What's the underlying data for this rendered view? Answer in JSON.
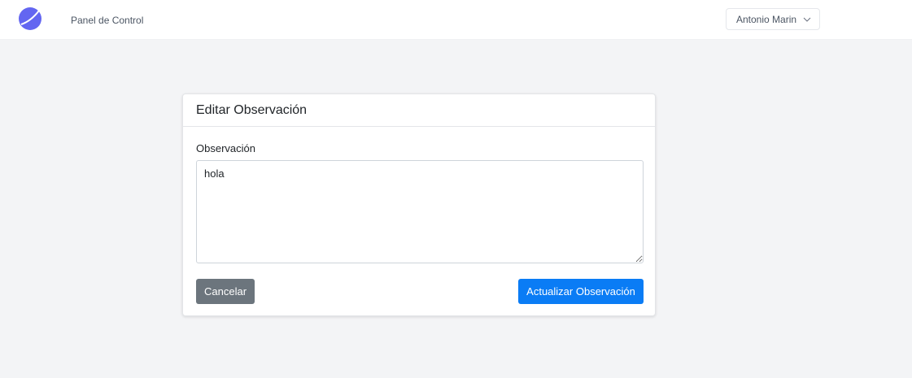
{
  "header": {
    "nav_link": "Panel de Control",
    "user_name": "Antonio Marin"
  },
  "card": {
    "title": "Editar Observación",
    "field_label": "Observación",
    "textarea_value": "hola",
    "cancel_label": "Cancelar",
    "submit_label": "Actualizar Observación"
  },
  "colors": {
    "logo": "#6366f1",
    "primary_button": "#0a7cf5",
    "secondary_button": "#6c757d",
    "page_background": "#f3f4f6"
  },
  "icons": {
    "logo": "logo-icon",
    "user_menu_caret": "chevron-down-icon"
  }
}
